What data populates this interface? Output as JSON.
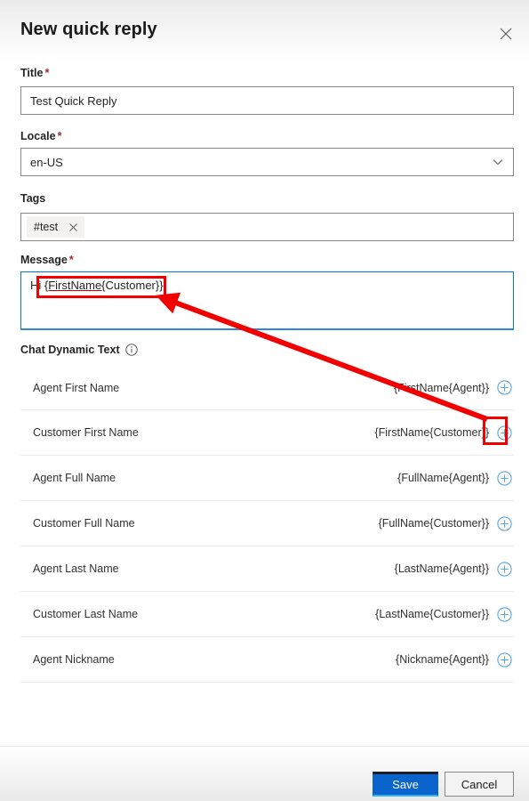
{
  "header": {
    "title": "New quick reply",
    "close_icon": "close-icon"
  },
  "form": {
    "title_field": {
      "label": "Title",
      "required_mark": "*",
      "value": "Test Quick Reply"
    },
    "locale_field": {
      "label": "Locale",
      "required_mark": "*",
      "value": "en-US",
      "chevron_icon": "chevron-down-icon"
    },
    "tags_field": {
      "label": "Tags",
      "chip_label": "#test",
      "chip_remove_icon": "close-icon"
    },
    "message_field": {
      "label": "Message",
      "required_mark": "*",
      "value_prefix": "Hi ",
      "value_token": "{FirstName{",
      "value_suffix": "Customer}}"
    }
  },
  "dynamic_text": {
    "heading": "Chat Dynamic Text",
    "info_icon": "info-icon",
    "add_icon": "add-circle-icon",
    "rows": [
      {
        "name": "Agent First Name",
        "token": "{FirstName{Agent}}"
      },
      {
        "name": "Customer First Name",
        "token": "{FirstName{Customer}}"
      },
      {
        "name": "Agent Full Name",
        "token": "{FullName{Agent}}"
      },
      {
        "name": "Customer Full Name",
        "token": "{FullName{Customer}}"
      },
      {
        "name": "Agent Last Name",
        "token": "{LastName{Agent}}"
      },
      {
        "name": "Customer Last Name",
        "token": "{LastName{Customer}}"
      },
      {
        "name": "Agent Nickname",
        "token": "{Nickname{Agent}}"
      }
    ]
  },
  "footer": {
    "save_label": "Save",
    "cancel_label": "Cancel"
  },
  "annotation": {
    "color": "#f20000"
  }
}
